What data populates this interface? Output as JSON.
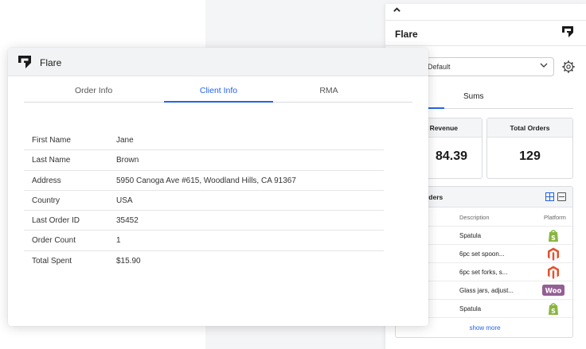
{
  "sidebar": {
    "collapse_icon": "chevron-up-icon",
    "title": "Flare",
    "select_value": "Default",
    "tab_sums": "Sums",
    "cards": [
      {
        "label": "l Revenue",
        "value": "84.39"
      },
      {
        "label": "Total Orders",
        "value": "129"
      }
    ],
    "orders": {
      "title": "rders",
      "col_description": "Description",
      "col_platform": "Platform",
      "rows": [
        {
          "description": "Spatula",
          "platform": "shopify"
        },
        {
          "description": "6pc set spoon...",
          "platform": "magento"
        },
        {
          "description": "6pc set forks, s...",
          "platform": "magento"
        },
        {
          "description": "Glass jars, adjust...",
          "platform": "woocommerce"
        },
        {
          "description": "Spatula",
          "platform": "shopify"
        }
      ],
      "show_more": "show more",
      "woo_text": "Woo"
    }
  },
  "window": {
    "title": "Flare",
    "tabs": [
      "Order Info",
      "Client Info",
      "RMA"
    ],
    "active_tab": "Client Info",
    "fields": [
      {
        "label": "First Name",
        "value": "Jane"
      },
      {
        "label": "Last Name",
        "value": "Brown"
      },
      {
        "label": "Address",
        "value": "5950 Canoga Ave #615, Woodland Hills, CA 91367"
      },
      {
        "label": "Country",
        "value": "USA"
      },
      {
        "label": "Last Order ID",
        "value": "35452"
      },
      {
        "label": "Order Count",
        "value": "1"
      },
      {
        "label": "Total Spent",
        "value": "$15.90"
      }
    ]
  },
  "colors": {
    "accent": "#2563eb",
    "shopify": "#8ab53f",
    "magento": "#e2522b",
    "woocommerce": "#935f95"
  }
}
